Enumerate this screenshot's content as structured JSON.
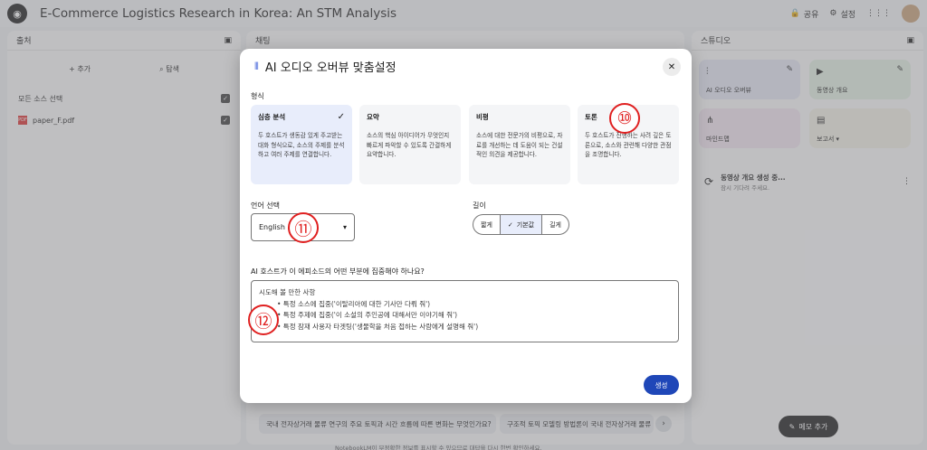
{
  "app": {
    "title": "E-Commerce Logistics Research in Korea: An STM Analysis",
    "share_label": "공유",
    "settings_label": "설정"
  },
  "sources": {
    "title": "출처",
    "add_label": "추가",
    "explore_label": "탐색",
    "select_all_label": "모든 소스 선택",
    "items": [
      {
        "name": "paper_F.pdf",
        "icon": "pdf-icon"
      }
    ]
  },
  "chat": {
    "title": "채팅",
    "suggestions": [
      "국내 전자상거래 물류 연구의 주요 토픽과 시간 흐름에 따른 변화는 무엇인가요?",
      "구조적 토픽 모델링 방법론이 국내 전자상거래 물류"
    ],
    "footer_note": "NotebookLM이 부정확한 정보를 표시할 수 있으므로 대답을 다시 한번 확인하세요."
  },
  "studio": {
    "title": "스튜디오",
    "tiles": [
      {
        "label": "AI 오디오 오버뷰",
        "color": "#e6e8f5",
        "icon": "waveform-icon"
      },
      {
        "label": "동영상 개요",
        "color": "#e4f1e4",
        "icon": "video-icon"
      },
      {
        "label": "마인드맵",
        "color": "#f2e6f0",
        "icon": "mindmap-icon"
      },
      {
        "label": "보고서",
        "color": "#f3f1e6",
        "icon": "report-icon"
      }
    ],
    "generating_title": "동영상 개요 생성 중...",
    "generating_sub": "잠시 기다려 주세요.",
    "memo_label": "메모 추가"
  },
  "modal": {
    "title": "AI 오디오 오버뷰 맞춤설정",
    "format_label": "형식",
    "formats": [
      {
        "name": "심층 분석",
        "desc": "두 호스트가 생동감 있게 주고받는 대화 형식으로, 소스의 주제를 분석하고 여러 주제를 연결합니다.",
        "selected": true
      },
      {
        "name": "요약",
        "desc": "소스의 핵심 아이디어가 무엇인지 빠르게 파악할 수 있도록 간결하게 요약합니다.",
        "selected": false
      },
      {
        "name": "비평",
        "desc": "소스에 대한 전문가의 비평으로, 자료를 개선하는 데 도움이 되는 건설적인 의견을 제공합니다.",
        "selected": false
      },
      {
        "name": "토론",
        "desc": "두 호스트가 진행하는 사려 깊은 토론으로, 소스와 관련해 다양한 관점을 조명합니다.",
        "selected": false
      }
    ],
    "language_label": "언어 선택",
    "language_value": "English",
    "length_label": "길이",
    "length_options": [
      "짧게",
      "기본값",
      "길게"
    ],
    "length_selected": "기본값",
    "focus_label": "AI 호스트가 이 에피소드의 어떤 부분에 집중해야 하나요?",
    "focus_lines": [
      "시도해 볼 만한 사항",
      "• 특정 소스에 집중('이탈리아에 대한 기사만 다뤄 줘')",
      "• 특정 주제에 집중('이 소설의 주인공에 대해서만 이야기해 줘')",
      "• 특정 잠재 사용자 타겟팅('생물학을 처음 접하는 사람에게 설명해 줘')"
    ],
    "generate_label": "생성"
  },
  "markers": [
    "⑩",
    "⑪",
    "⑫"
  ]
}
